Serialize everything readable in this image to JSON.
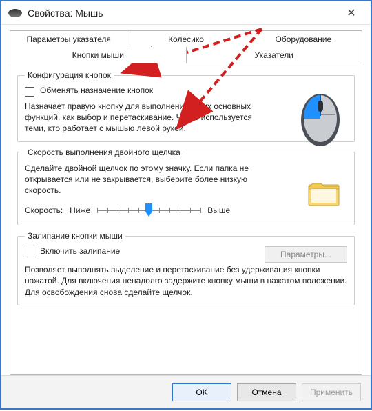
{
  "window": {
    "title": "Свойства: Мышь"
  },
  "tabs": {
    "row1": [
      "Параметры указателя",
      "Колесико",
      "Оборудование"
    ],
    "row2": [
      "Кнопки мыши",
      "Указатели"
    ],
    "active": "Кнопки мыши"
  },
  "buttons_group": {
    "legend": "Конфигурация кнопок",
    "swap_label": "Обменять назначение кнопок",
    "swap_checked": false,
    "desc": "Назначает правую кнопку для выполнения таких основных функций, как выбор и перетаскивание. Часто используется теми, кто работает с мышью левой рукой."
  },
  "doubleclick_group": {
    "legend": "Скорость выполнения двойного щелчка",
    "desc": "Сделайте двойной щелчок по этому значку. Если папка не открывается или не закрывается, выберите более низкую скорость.",
    "speed_label": "Скорость:",
    "slow_label": "Ниже",
    "fast_label": "Выше",
    "slider_value": 5,
    "slider_max": 10
  },
  "clicklock_group": {
    "legend": "Залипание кнопки мыши",
    "enable_label": "Включить залипание",
    "enable_checked": false,
    "params_button": "Параметры...",
    "params_enabled": false,
    "desc": "Позволяет выполнять выделение и перетаскивание без удерживания кнопки нажатой. Для включения ненадолго задержите кнопку мыши в нажатом положении. Для освобождения снова сделайте щелчок."
  },
  "footer": {
    "ok": "OK",
    "cancel": "Отмена",
    "apply": "Применить",
    "apply_enabled": false
  }
}
